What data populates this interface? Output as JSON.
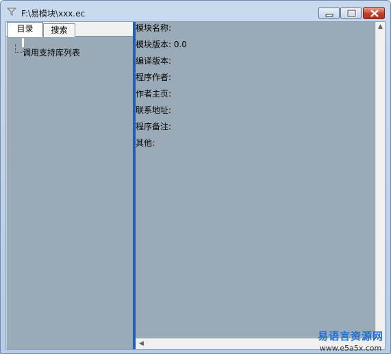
{
  "window": {
    "title": "F:\\易模块\\xxx.ec",
    "icon": "funnel-icon",
    "controls": [
      "minimize",
      "maximize",
      "close"
    ]
  },
  "tabs": [
    {
      "label": "目录",
      "active": true
    },
    {
      "label": "搜索",
      "active": false
    }
  ],
  "tree": {
    "items": [
      {
        "label": "调用支持库列表"
      }
    ]
  },
  "module_info": {
    "lines": [
      "模块名称:",
      "模块版本: 0.0",
      "编译版本:",
      "程序作者:",
      "作者主页:",
      "联系地址:",
      "程序备注:",
      "其他:"
    ]
  },
  "watermark": {
    "text": "易语言资源网",
    "url": "www.e5a5x.com"
  },
  "colors": {
    "pane_bg": "#9aabb7",
    "splitter": "#1f5fb8",
    "title_bar": "#c9daee",
    "watermark": "#1f6fd6"
  }
}
